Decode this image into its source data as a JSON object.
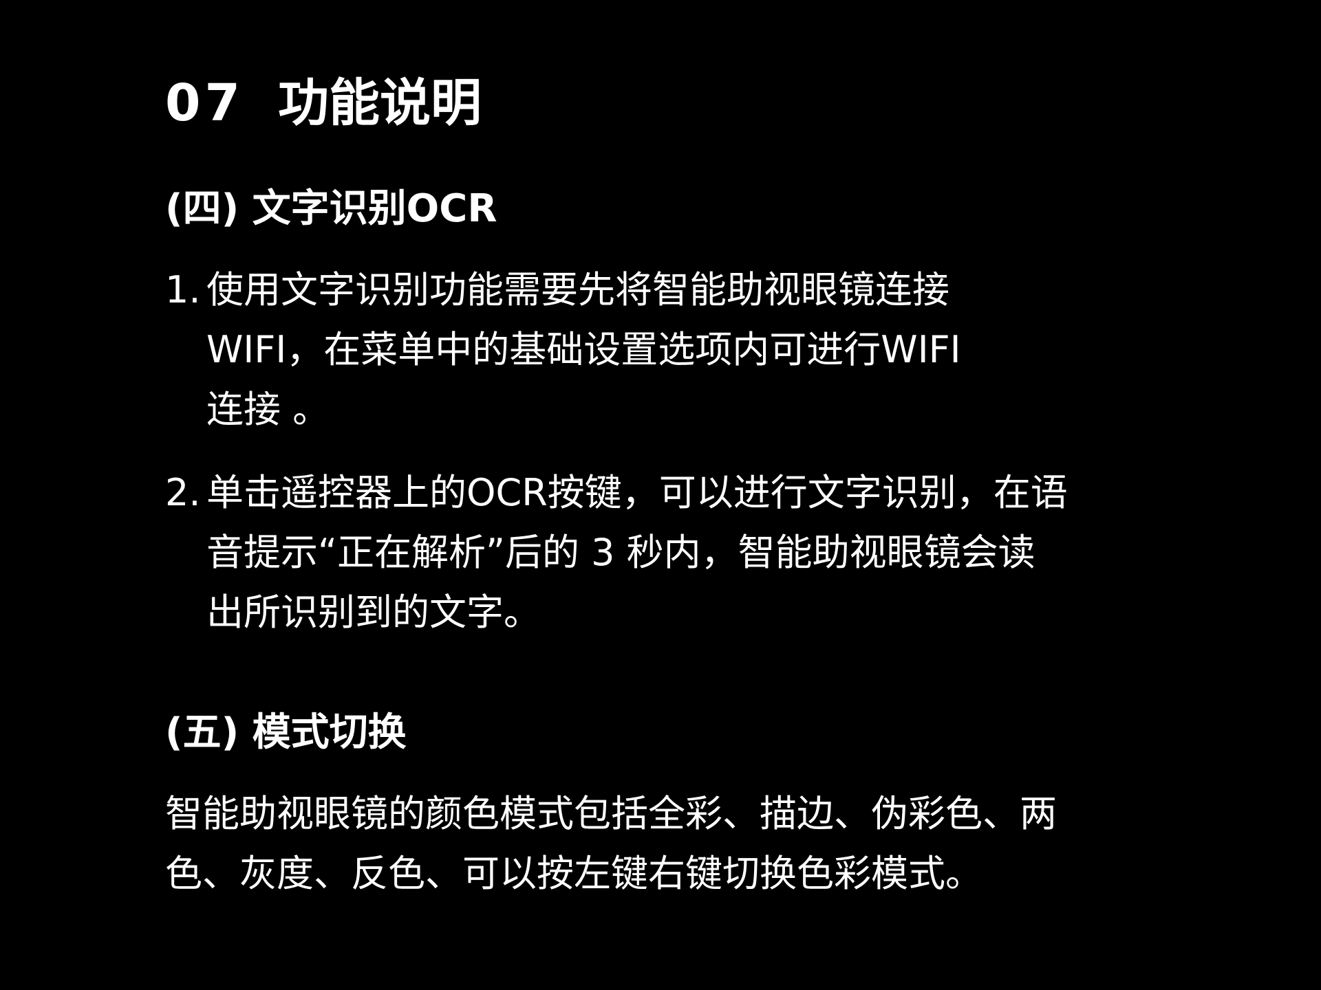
{
  "section": {
    "number": "07",
    "title": "功能说明"
  },
  "ocr": {
    "heading": "(四) 文字识别OCR",
    "items": [
      {
        "marker": "1.",
        "lines": [
          "使用文字识别功能需要先将智能助视眼镜连接",
          "WIFI，在菜单中的基础设置选项内可进行WIFI",
          "连接 。"
        ]
      },
      {
        "marker": "2.",
        "lines": [
          "单击遥控器上的OCR按键，可以进行文字识别，在语",
          "音提示“正在解析”后的 3 秒内，智能助视眼镜会读",
          "出所识别到的文字。"
        ]
      }
    ]
  },
  "mode": {
    "heading": "(五) 模式切换",
    "lines": [
      "智能助视眼镜的颜色模式包括全彩、描边、伪彩色、两",
      "色、灰度、反色、可以按左键右键切换色彩模式。"
    ]
  }
}
